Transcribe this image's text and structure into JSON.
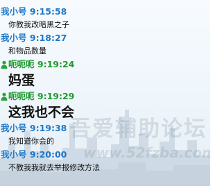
{
  "messages": [
    {
      "sender": "我小号",
      "time": "9:15:58",
      "text": "你教我改暗黑之子",
      "style": "small",
      "is_self": true
    },
    {
      "sender": "我小号",
      "time": "9:18:27",
      "text": "和物品数量",
      "style": "small",
      "is_self": true
    },
    {
      "sender": "呃呃呃",
      "time": "9:19:24",
      "text": "妈蛋",
      "style": "big",
      "is_self": false
    },
    {
      "sender": "呃呃呃",
      "time": "9:19:29",
      "text": "这我也不会",
      "style": "big",
      "is_self": false
    },
    {
      "sender": "我小号",
      "time": "9:19:38",
      "text": "我知道你会的",
      "style": "small",
      "is_self": true
    },
    {
      "sender": "我小号",
      "time": "9:20:00",
      "text": "不教我我就去举报修改方法",
      "style": "small",
      "is_self": true
    }
  ],
  "watermark": {
    "text": "吾爱辅助论坛",
    "url": "www.52fzba.com"
  },
  "colors": {
    "self_name": "#1f78c8",
    "other_name": "#1f9a2e",
    "message_text": "#111111",
    "background": "#f2f7fc"
  },
  "icons": {
    "other_sender": "person-icon"
  }
}
